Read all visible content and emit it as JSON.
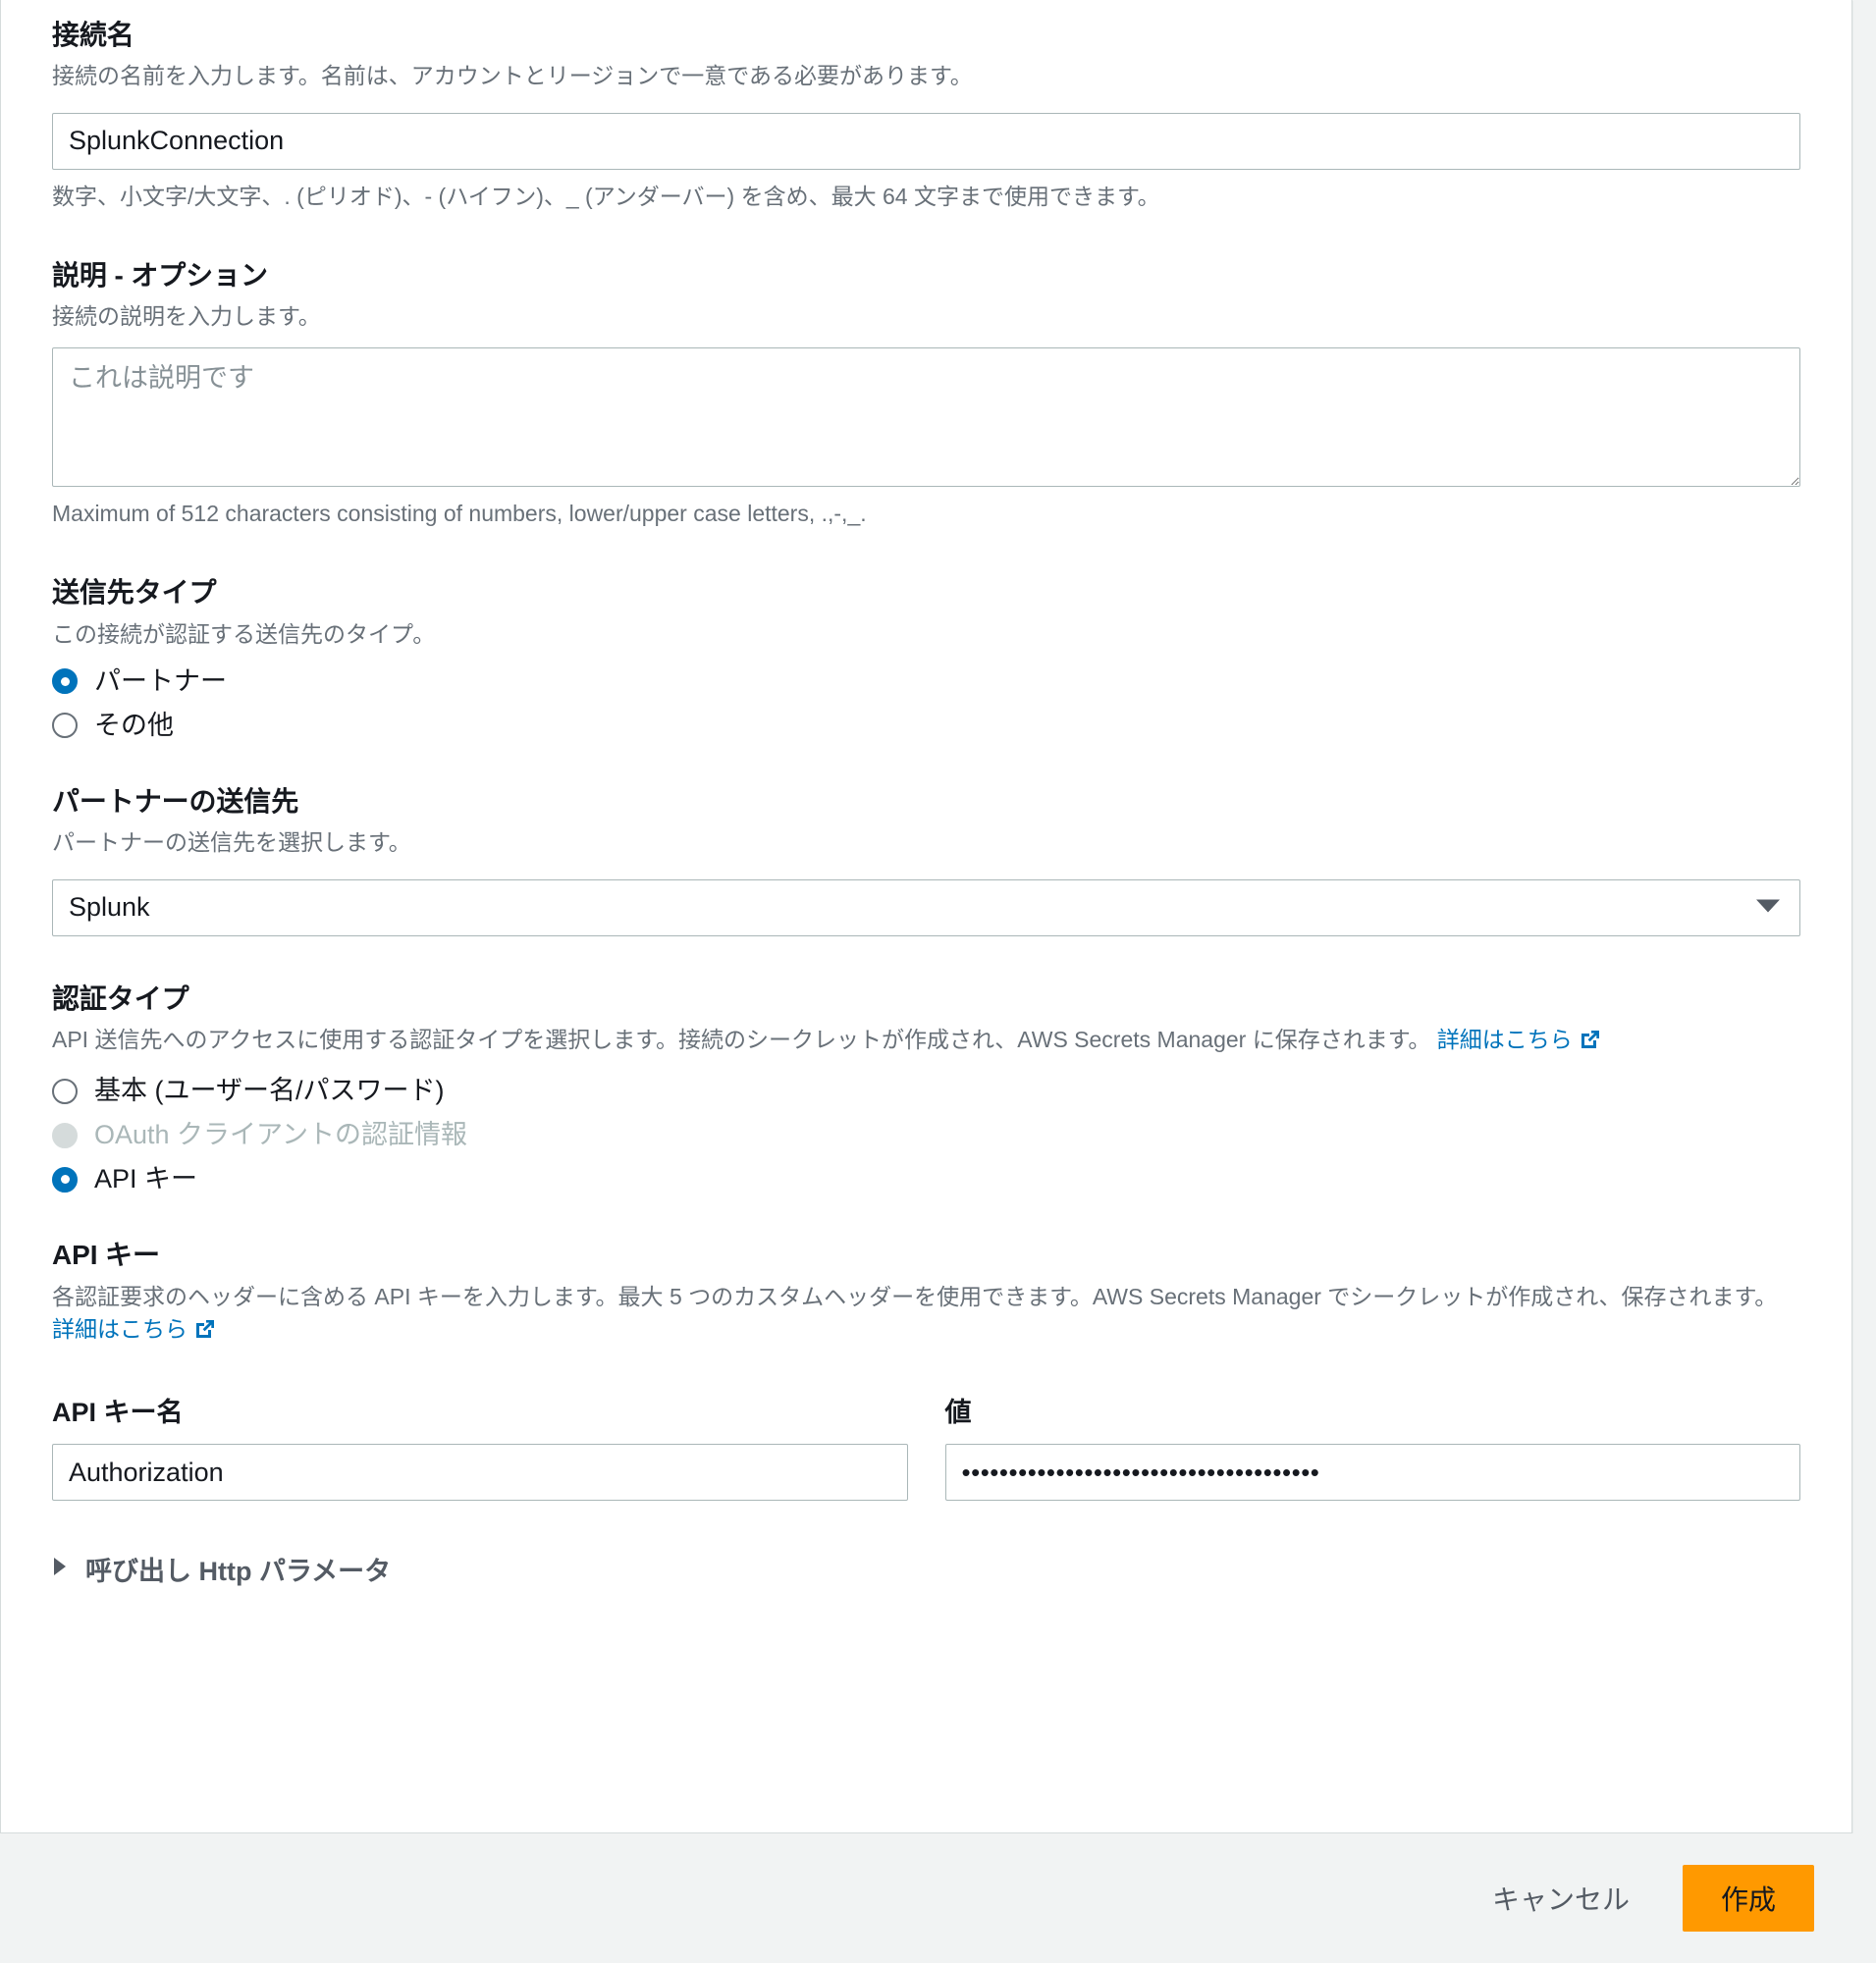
{
  "form": {
    "connection_name": {
      "label": "接続名",
      "description": "接続の名前を入力します。名前は、アカウントとリージョンで一意である必要があります。",
      "value": "SplunkConnection",
      "constraint": "数字、小文字/大文字、. (ピリオド)、- (ハイフン)、_ (アンダーバー) を含め、最大 64 文字まで使用できます。"
    },
    "description": {
      "label": "説明 - オプション",
      "description": "接続の説明を入力します。",
      "placeholder": "これは説明です",
      "constraint": "Maximum of 512 characters consisting of numbers, lower/upper case letters, .,-,_."
    },
    "destination_type": {
      "label": "送信先タイプ",
      "description": "この接続が認証する送信先のタイプ。",
      "options": [
        {
          "label": "パートナー",
          "selected": true,
          "disabled": false
        },
        {
          "label": "その他",
          "selected": false,
          "disabled": false
        }
      ]
    },
    "partner_destination": {
      "label": "パートナーの送信先",
      "description": "パートナーの送信先を選択します。",
      "selected": "Splunk"
    },
    "auth_type": {
      "label": "認証タイプ",
      "description_part1": "API 送信先へのアクセスに使用する認証タイプを選択します。接続のシークレットが作成され、AWS Secrets Manager に保存されます。 ",
      "learn_more": "詳細はこちら",
      "options": [
        {
          "label": "基本 (ユーザー名/パスワード)",
          "selected": false,
          "disabled": false
        },
        {
          "label": "OAuth クライアントの認証情報",
          "selected": false,
          "disabled": true
        },
        {
          "label": "API キー",
          "selected": true,
          "disabled": false
        }
      ]
    },
    "api_key": {
      "label": "API キー",
      "description_part1": "各認証要求のヘッダーに含める API キーを入力します。最大 5 つのカスタムヘッダーを使用できます。AWS Secrets Manager でシークレットが作成され、保存されます。 ",
      "learn_more": "詳細はこちら",
      "name_label": "API キー名",
      "name_value": "Authorization",
      "value_label": "値",
      "value_masked": "••••••••••••••••••••••••••••••••••••••"
    },
    "http_params_expandable": {
      "label": "呼び出し Http パラメータ",
      "expanded": false
    }
  },
  "footer": {
    "cancel_label": "キャンセル",
    "create_label": "作成"
  },
  "colors": {
    "accent_link": "#0073bb",
    "primary_button": "#ff9900",
    "radio_selected": "#0073bb",
    "border": "#aab7b8",
    "page_background": "#f1f3f3"
  }
}
